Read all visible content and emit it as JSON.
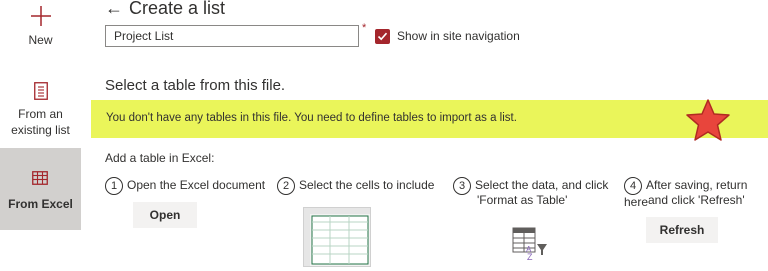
{
  "sidebar": {
    "items": [
      {
        "label": "New",
        "icon": "plus-icon"
      },
      {
        "label_line1": "From an",
        "label_line2": "existing list",
        "icon": "list-doc-icon"
      },
      {
        "label": "From Excel",
        "icon": "excel-table-icon",
        "active": true
      }
    ]
  },
  "header": {
    "back_arrow": "←",
    "title": "Create a list"
  },
  "form": {
    "name_value": "Project List",
    "required_mark": "*",
    "show_in_nav_label": "Show in site navigation",
    "show_in_nav_checked": true
  },
  "section": {
    "title": "Select a table from this file."
  },
  "banner": {
    "text": "You don't have any tables in this file. You need to define tables to import as a list."
  },
  "steps": {
    "heading": "Add a table in Excel:",
    "items": [
      {
        "num": "1",
        "line1": "Open the Excel document",
        "line2": "",
        "button": "Open"
      },
      {
        "num": "2",
        "line1": "Select the cells to include",
        "line2": "",
        "button": ""
      },
      {
        "num": "3",
        "line1": "Select the data, and click",
        "line2": "'Format as Table'",
        "button": ""
      },
      {
        "num": "4",
        "line1": "After saving, return here",
        "line2": "and click 'Refresh'",
        "button": "Refresh"
      }
    ]
  },
  "colors": {
    "accent": "#a4262c",
    "banner": "#eaf55a",
    "active_sidebar": "#d2d0ce",
    "star": "#e8453c"
  }
}
